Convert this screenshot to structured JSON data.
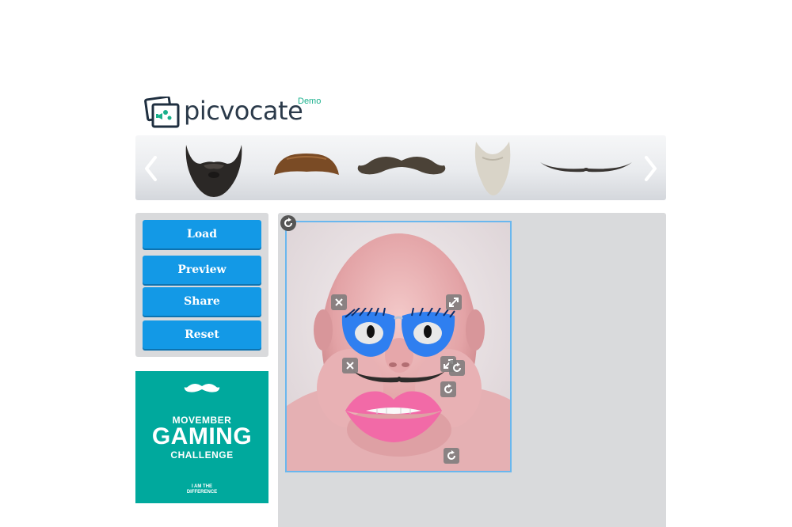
{
  "app": {
    "name": "picvocate",
    "badge": "Demo",
    "accent_color": "#1399e6",
    "brand_color": "#19b08c"
  },
  "carousel": {
    "prev_icon": "chevron-left-icon",
    "next_icon": "chevron-right-icon",
    "items": [
      {
        "name": "full-beard",
        "icon": "beard-icon"
      },
      {
        "name": "brush-mustache",
        "icon": "mustache-icon"
      },
      {
        "name": "handlebar-mustache",
        "icon": "mustache-icon"
      },
      {
        "name": "white-goatee",
        "icon": "goatee-icon"
      },
      {
        "name": "thin-long-mustache",
        "icon": "mustache-icon"
      }
    ]
  },
  "sidebar": {
    "buttons": [
      {
        "label": "Load"
      },
      {
        "label": "Preview"
      },
      {
        "label": "Share"
      },
      {
        "label": "Reset"
      }
    ]
  },
  "ad": {
    "line1": "MOVEMBER",
    "line2": "GAMING",
    "line3": "CHALLENGE",
    "line4": "I AM THE DIFFERENCE",
    "background": "#00a99d"
  },
  "editor": {
    "frame_border_color": "#6ab7ee",
    "stickers": [
      "blue-eyelash-glasses",
      "thin-mustache",
      "pink-lips"
    ],
    "controls": [
      "rotate-icon",
      "remove-icon",
      "resize-icon"
    ]
  }
}
